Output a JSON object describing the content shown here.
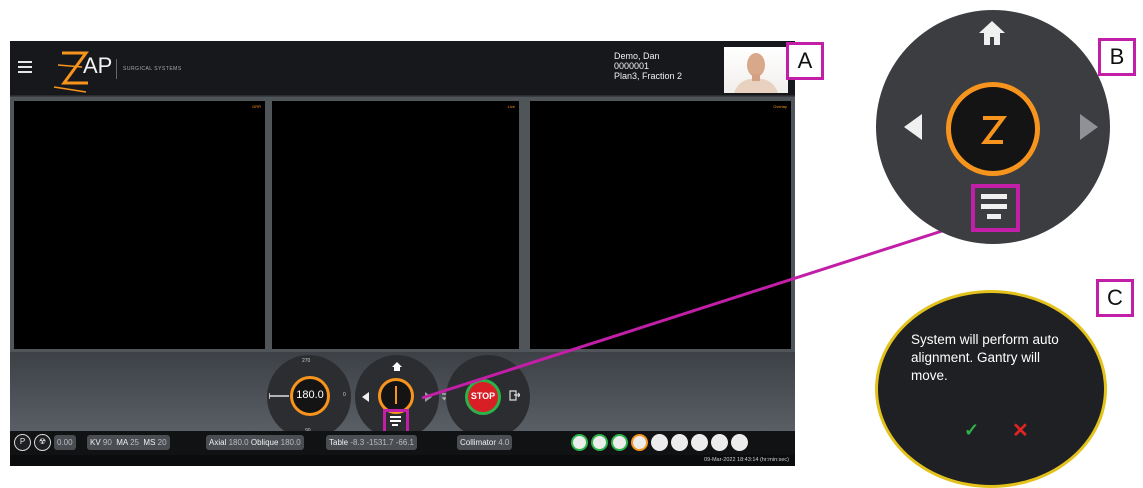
{
  "labels": {
    "a": "A",
    "b": "B",
    "c": "C"
  },
  "app": {
    "brand": {
      "logo_text": "AP",
      "subtitle": "SURGICAL SYSTEMS"
    },
    "patient": {
      "name": "Demo, Dan",
      "id": "0000001",
      "plan": "Plan3, Fraction 2"
    },
    "viewports": [
      {
        "label": "DRR"
      },
      {
        "label": "Live"
      },
      {
        "label": "Overlay"
      }
    ],
    "gantry_control": {
      "value": "180.0",
      "top_tick": "270",
      "bottom_tick": "90",
      "right_tick": "0"
    },
    "stop_button": {
      "label": "STOP"
    },
    "statusbar": {
      "p_label": "P",
      "dose_value": "0.00",
      "kv_label": "KV",
      "kv_value": "90",
      "ma_label": "MA",
      "ma_value": "25",
      "ms_label": "MS",
      "ms_value": "20",
      "axial_label": "Axial",
      "axial_value": "180.0",
      "oblique_label": "Oblique",
      "oblique_value": "180.0",
      "table_label": "Table",
      "table_values": "-8.3  -1531.7  -66.1",
      "collimator_label": "Collimator",
      "collimator_value": "4.0",
      "datetime": "09-Mar-2022 18:43:14 (hr:min:sec)"
    }
  },
  "confirm": {
    "message": "System will perform auto alignment. Gantry will move.",
    "ok_symbol": "✓",
    "cancel_symbol": "✕"
  },
  "colors": {
    "accent": "#f7941d",
    "highlight": "#c21ea8",
    "ok": "#2db24a",
    "cancel": "#e02424",
    "stop": "#d81f26"
  }
}
